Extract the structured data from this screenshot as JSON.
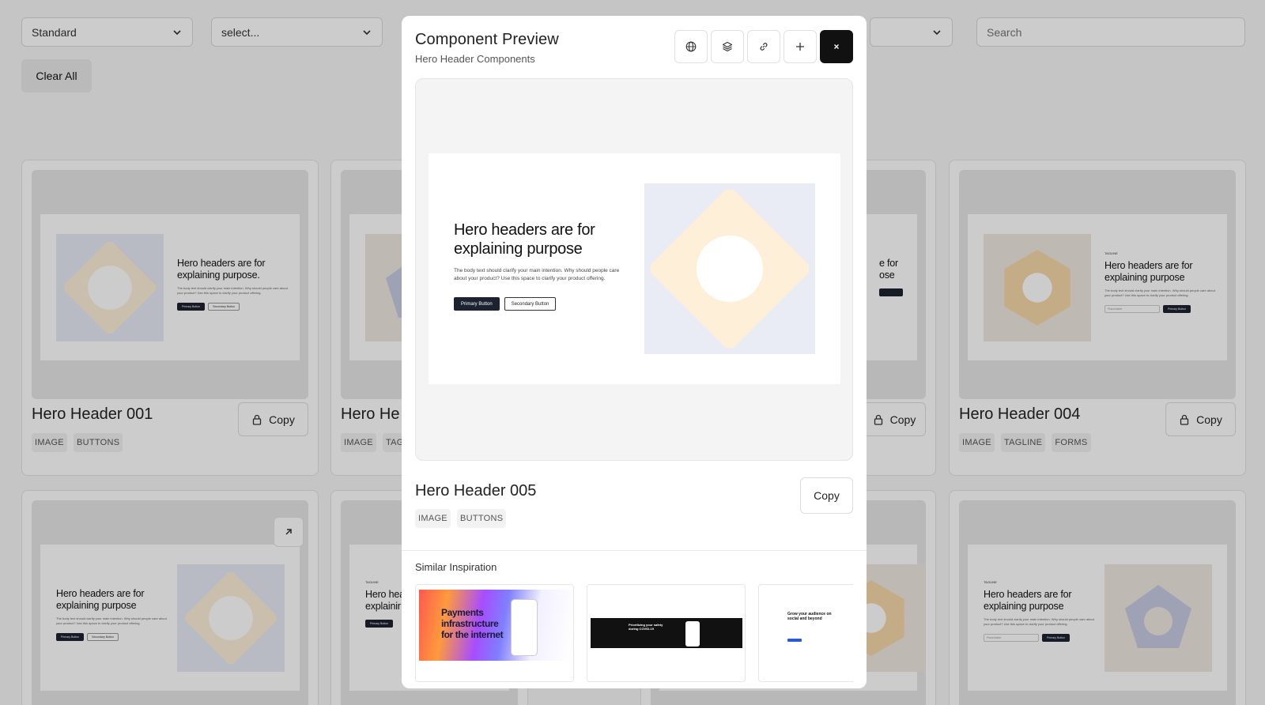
{
  "filters": {
    "layout_select": "Standard",
    "category_select": "select...",
    "search_placeholder": "Search",
    "clear_label": "Clear All"
  },
  "cards": [
    {
      "title": "Hero Header 001",
      "tags": [
        "IMAGE",
        "BUTTONS"
      ],
      "copy_label": "Copy"
    },
    {
      "title": "Hero He",
      "tags": [
        "IMAGE",
        "TAG"
      ]
    },
    {
      "copy_label": "Copy"
    },
    {
      "title": "Hero Header 004",
      "tags": [
        "IMAGE",
        "TAGLINE",
        "FORMS"
      ],
      "copy_label": "Copy"
    }
  ],
  "thumb_text": {
    "headline_a": "Hero headers are for explaining purpose.",
    "headline_b": "Hero headers are for explaining purpose",
    "body": "The body text should clarify your main intention. Why should people care about your product? Use this space to clarify your product offering.",
    "primary": "Primary Button",
    "secondary": "Secondary Button",
    "tagline": "TAGLINE",
    "placeholder": "Placeholder",
    "partial_a": "e for",
    "partial_b": "ose",
    "partial_c": "Hero hea",
    "partial_d": "explainir"
  },
  "modal": {
    "title": "Component Preview",
    "subtitle": "Hero Header Components",
    "tools": [
      "globe-icon",
      "layers-icon",
      "link-icon",
      "plus-icon",
      "close-icon"
    ],
    "preview": {
      "headline": "Hero headers are for explaining purpose",
      "body": "The body text should clarify your main intention. Why should people care about your product? Use this space to clarify your product offering.",
      "primary": "Primary Button",
      "secondary": "Secondary Button"
    },
    "component_title": "Hero Header 005",
    "tags": [
      "IMAGE",
      "BUTTONS"
    ],
    "copy_label": "Copy",
    "similar_label": "Similar Inspiration",
    "similar": [
      {
        "headline": "Payments infrastructure for the internet"
      },
      {
        "headline": "Prioritizing your safety during COVID-19"
      },
      {
        "headline": "Grow your audience on social and beyond"
      }
    ]
  },
  "colors": {
    "accent_dark": "#111111",
    "art_peach": "#fdefd8",
    "art_lavender": "#e9ebf5",
    "overlay": "rgba(0,0,0,0.2)"
  }
}
